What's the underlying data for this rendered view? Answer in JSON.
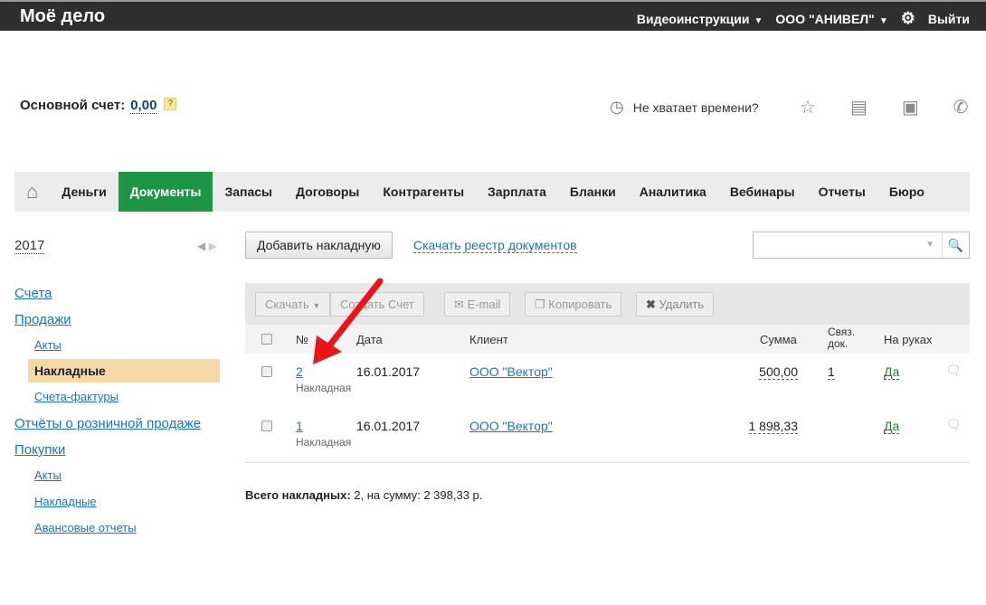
{
  "header": {
    "logo": "Моё дело",
    "video": "Видеоинструкции",
    "company": "ООО \"АНИВЕЛ\"",
    "logout": "Выйти"
  },
  "balance": {
    "label": "Основной счет:",
    "value": "0,00",
    "help": "?"
  },
  "helper": {
    "text": "Не хватает времени?"
  },
  "nav": [
    "Деньги",
    "Документы",
    "Запасы",
    "Договоры",
    "Контрагенты",
    "Зарплата",
    "Бланки",
    "Аналитика",
    "Вебинары",
    "Отчеты",
    "Бюро"
  ],
  "sidebar": {
    "year": "2017",
    "items": [
      "Счета",
      "Продажи",
      "Акты",
      "Накладные",
      "Счета-фактуры",
      "Отчёты о розничной продаже",
      "Покупки",
      "Акты",
      "Накладные",
      "Авансовые отчеты"
    ]
  },
  "actions": {
    "add": "Добавить накладную",
    "download_registry": "Скачать реестр документов",
    "search_placeholder": ""
  },
  "toolbar": {
    "download": "Скачать",
    "create_invoice": "Создать Счет",
    "email": "E-mail",
    "copy": "Копировать",
    "delete": "Удалить"
  },
  "columns": {
    "num": "№",
    "date": "Дата",
    "client": "Клиент",
    "sum": "Сумма",
    "linked1": "Связ.",
    "linked2": "док.",
    "on_hand": "На руках"
  },
  "rows": [
    {
      "num": "2",
      "type": "Накладная",
      "date": "16.01.2017",
      "client": "ООО \"Вектор\"",
      "sum": "500,00",
      "linked": "1",
      "on_hand": "Да"
    },
    {
      "num": "1",
      "type": "Накладная",
      "date": "16.01.2017",
      "client": "ООО \"Вектор\"",
      "sum": "1 898,33",
      "linked": "",
      "on_hand": "Да"
    }
  ],
  "total": {
    "label": "Всего накладных:",
    "text": " 2, на сумму: 2 398,33 р."
  }
}
